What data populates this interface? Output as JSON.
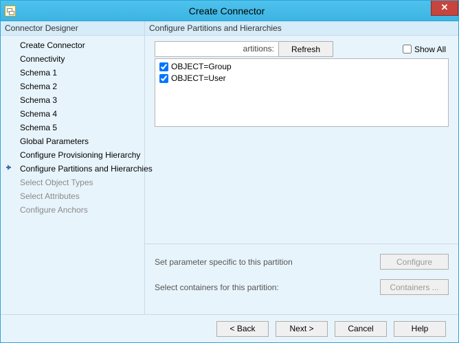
{
  "window": {
    "title": "Create Connector"
  },
  "sidebar": {
    "header": "Connector Designer",
    "items": [
      {
        "label": "Create Connector",
        "state": "done"
      },
      {
        "label": "Connectivity",
        "state": "done"
      },
      {
        "label": "Schema 1",
        "state": "done"
      },
      {
        "label": "Schema 2",
        "state": "done"
      },
      {
        "label": "Schema 3",
        "state": "done"
      },
      {
        "label": "Schema 4",
        "state": "done"
      },
      {
        "label": "Schema 5",
        "state": "done"
      },
      {
        "label": "Global Parameters",
        "state": "done"
      },
      {
        "label": "Configure Provisioning Hierarchy",
        "state": "done"
      },
      {
        "label": "Configure Partitions and Hierarchies",
        "state": "current"
      },
      {
        "label": "Select Object Types",
        "state": "disabled"
      },
      {
        "label": "Select Attributes",
        "state": "disabled"
      },
      {
        "label": "Configure Anchors",
        "state": "disabled"
      }
    ]
  },
  "main": {
    "header": "Configure Partitions and Hierarchies",
    "toolbar": {
      "partitions_label": "artitions:",
      "refresh": "Refresh",
      "show_all": "Show All",
      "show_all_checked": false
    },
    "partitions": [
      {
        "label": "OBJECT=Group",
        "checked": true
      },
      {
        "label": "OBJECT=User",
        "checked": true
      }
    ],
    "param_text": "Set parameter specific to this partition",
    "configure_btn": "Configure",
    "containers_text": "Select containers for this partition:",
    "containers_btn": "Containers ..."
  },
  "footer": {
    "back": "<  Back",
    "next": "Next  >",
    "cancel": "Cancel",
    "help": "Help"
  }
}
